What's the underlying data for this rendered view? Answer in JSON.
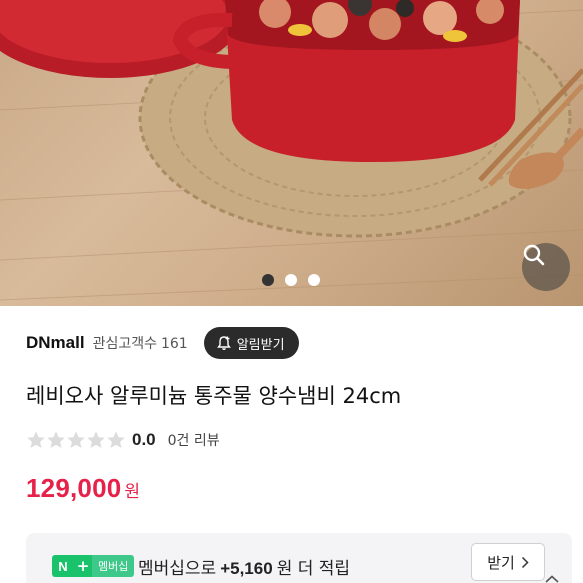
{
  "hero": {
    "active_slide": 1,
    "slide_count": 3,
    "zoom_icon": "search-icon"
  },
  "seller": {
    "name": "DNmall",
    "fans_label": "관심고객수",
    "fans_count": "161",
    "alert_label": "알림받기",
    "alert_icon": "bell-plus-icon"
  },
  "product": {
    "title": "레비오사 알루미늄 통주물 양수냄비 24cm"
  },
  "rating": {
    "stars_filled": 0,
    "stars_total": 5,
    "score": "0.0",
    "review_count": "0건 리뷰"
  },
  "price": {
    "amount": "129,000",
    "unit": "원"
  },
  "membership": {
    "badge_n": "N",
    "badge_plus": "+",
    "badge_label": "멤버십",
    "text_before": "멤버십으로",
    "points": "+5,160",
    "text_after": "원 더 적립",
    "receive_label": "받기",
    "receive_icon": "chevron-right-icon"
  },
  "colors": {
    "price": "#e6224a",
    "naver_green": "#19c26b",
    "pot_red": "#c8202b"
  }
}
